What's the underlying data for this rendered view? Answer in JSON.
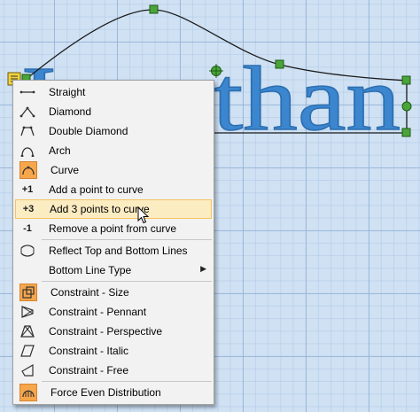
{
  "canvas": {
    "text": "Jonathan",
    "background_color": "#cfe1f3",
    "text_color": "#3b86cf",
    "handle_color": "#4aa43a"
  },
  "context_menu": {
    "items": [
      {
        "label": "Straight",
        "icon": "straight-line-icon"
      },
      {
        "label": "Diamond",
        "icon": "diamond-icon"
      },
      {
        "label": "Double Diamond",
        "icon": "double-diamond-icon"
      },
      {
        "label": "Arch",
        "icon": "arch-icon"
      },
      {
        "label": "Curve",
        "icon": "curve-icon",
        "checked": true
      },
      {
        "label": "Add a point to curve",
        "icon": "plus-one-icon",
        "glyph": "+1"
      },
      {
        "label": "Add 3 points to curve",
        "icon": "plus-three-icon",
        "glyph": "+3",
        "highlighted": true
      },
      {
        "label": "Remove a point from curve",
        "icon": "minus-one-icon",
        "glyph": "-1"
      },
      {
        "label": "Reflect Top and Bottom Lines",
        "icon": "reflect-icon"
      },
      {
        "label": "Bottom Line Type",
        "icon": "",
        "submenu": true
      },
      {
        "label": "Constraint - Size",
        "icon": "constraint-size-icon",
        "checked": true
      },
      {
        "label": "Constraint - Pennant",
        "icon": "constraint-pennant-icon"
      },
      {
        "label": "Constraint - Perspective",
        "icon": "constraint-perspective-icon"
      },
      {
        "label": "Constraint - Italic",
        "icon": "constraint-italic-icon"
      },
      {
        "label": "Constraint - Free",
        "icon": "constraint-free-icon"
      },
      {
        "label": "Force Even Distribution",
        "icon": "force-even-distribution-icon",
        "checked": true
      }
    ],
    "highlight_color": "#fcecc2",
    "checked_color": "#f6a64b"
  }
}
